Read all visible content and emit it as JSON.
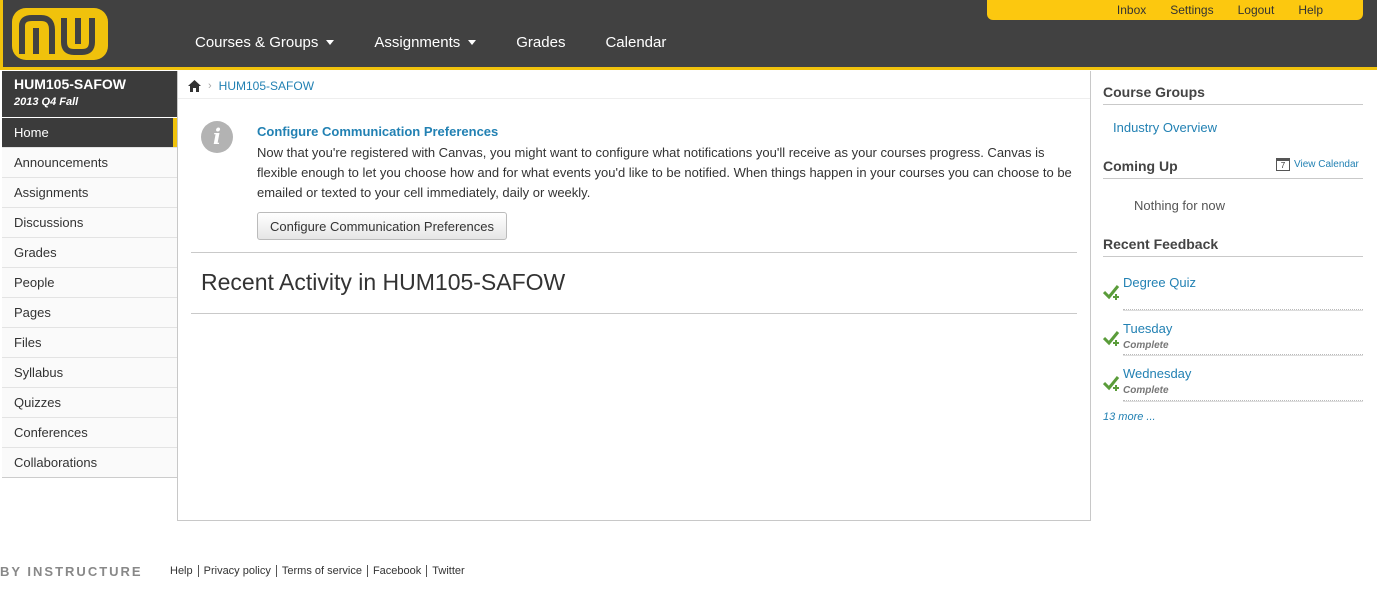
{
  "header": {
    "nav": [
      {
        "label": "Courses & Groups",
        "has_caret": true
      },
      {
        "label": "Assignments",
        "has_caret": true
      },
      {
        "label": "Grades",
        "has_caret": false
      },
      {
        "label": "Calendar",
        "has_caret": false
      }
    ],
    "user_links": [
      "Inbox",
      "Settings",
      "Logout",
      "Help"
    ],
    "colors": {
      "bar": "#414141",
      "accent": "#f0c20c"
    }
  },
  "course": {
    "name": "HUM105-SAFOW",
    "term": "2013 Q4 Fall",
    "nav": [
      "Home",
      "Announcements",
      "Assignments",
      "Discussions",
      "Grades",
      "People",
      "Pages",
      "Files",
      "Syllabus",
      "Quizzes",
      "Conferences",
      "Collaborations"
    ],
    "active": "Home"
  },
  "breadcrumb": {
    "home_icon": "home-icon",
    "current": "HUM105-SAFOW"
  },
  "notice": {
    "icon": "info-icon",
    "title": "Configure Communication Preferences",
    "body": "Now that you're registered with Canvas, you might want to configure what notifications you'll receive as your courses progress. Canvas is flexible enough to let you choose how and for what events you'd like to be notified. When things happen in your courses you can choose to be emailed or texted to your cell immediately, daily or weekly.",
    "button": "Configure Communication Preferences"
  },
  "activity": {
    "title": "Recent Activity in HUM105-SAFOW"
  },
  "sidebar": {
    "course_groups": {
      "title": "Course Groups",
      "items": [
        "Industry Overview"
      ]
    },
    "coming_up": {
      "title": "Coming Up",
      "calendar_link": "View Calendar",
      "calendar_icon_text": "7",
      "empty": "Nothing for now"
    },
    "recent_feedback": {
      "title": "Recent Feedback",
      "items": [
        {
          "title": "Degree Quiz",
          "status": ""
        },
        {
          "title": "Tuesday",
          "status": "Complete"
        },
        {
          "title": "Wednesday",
          "status": "Complete"
        }
      ],
      "more": "13 more ..."
    }
  },
  "footer": {
    "brand": "BY INSTRUCTURE",
    "links": [
      "Help",
      "Privacy policy",
      "Terms of service",
      "Facebook",
      "Twitter"
    ]
  }
}
